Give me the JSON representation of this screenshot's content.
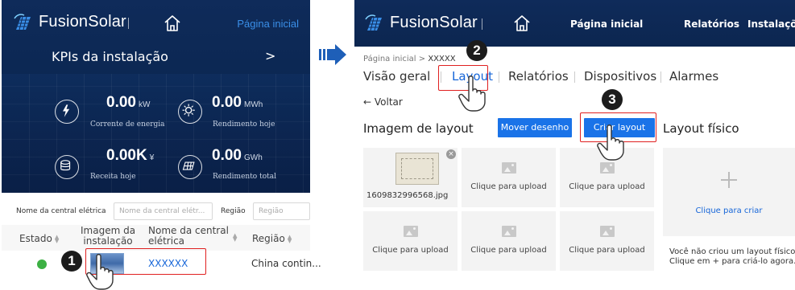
{
  "left": {
    "brand": "FusionSolar",
    "nav_link": "Página inicial",
    "kpi_title": "KPIs da instalação",
    "kpi_more": ">",
    "kpis": [
      {
        "value": "0.00",
        "unit": "kW",
        "label": "Corrente de energia",
        "icon": "lightning-icon"
      },
      {
        "value": "0.00",
        "unit": "MWh",
        "label": "Rendimento hoje",
        "icon": "sun-icon"
      },
      {
        "value": "0.00K",
        "unit": "¥",
        "label": "Receita hoje",
        "icon": "coins-icon"
      },
      {
        "value": "0.00",
        "unit": "GWh",
        "label": "Rendimento total",
        "icon": "solar-panel-icon"
      }
    ],
    "filters": {
      "name_label": "Nome da central elétrica",
      "name_placeholder": "Nome da central elétr...",
      "region_label": "Região",
      "region_placeholder": "Região"
    },
    "table": {
      "headers": [
        "Estado",
        "Imagem da instalação",
        "Nome da central elétrica",
        "Região"
      ],
      "header_lines": [
        [
          "Estado"
        ],
        [
          "Imagem da",
          "instalação"
        ],
        [
          "Nome da central",
          "elétrica"
        ],
        [
          "Região"
        ]
      ],
      "row": {
        "status_color": "#3cb043",
        "name": "XXXXXX",
        "region": "China contin..."
      }
    }
  },
  "right": {
    "brand": "FusionSolar",
    "nav": [
      "Página inicial",
      "Relatórios",
      "Instalações"
    ],
    "breadcrumb_home": "Página inicial",
    "breadcrumb_sep": ">",
    "breadcrumb_current": "XXXXX",
    "tabs": [
      "Visão geral",
      "Layout",
      "Relatórios",
      "Dispositivos",
      "Alarmes"
    ],
    "active_tab": "Layout",
    "back": "← Voltar",
    "section_title": "Imagem de layout",
    "move_button": "Mover desenho",
    "create_button": "Criar layout",
    "physical_title": "Layout físico",
    "uploaded_file": "1609832996568.jpg",
    "upload_label": "Clique para upload",
    "create_label": "Clique para criar",
    "note_line1": "Você não criou um layout físico.",
    "note_line2": "Clique em + para criá-lo agora."
  },
  "steps": [
    "1",
    "2",
    "3"
  ],
  "colors": {
    "header_bg": "#0f2b5a",
    "accent": "#1a73e8",
    "highlight": "#e02020",
    "link": "#1565d8"
  }
}
